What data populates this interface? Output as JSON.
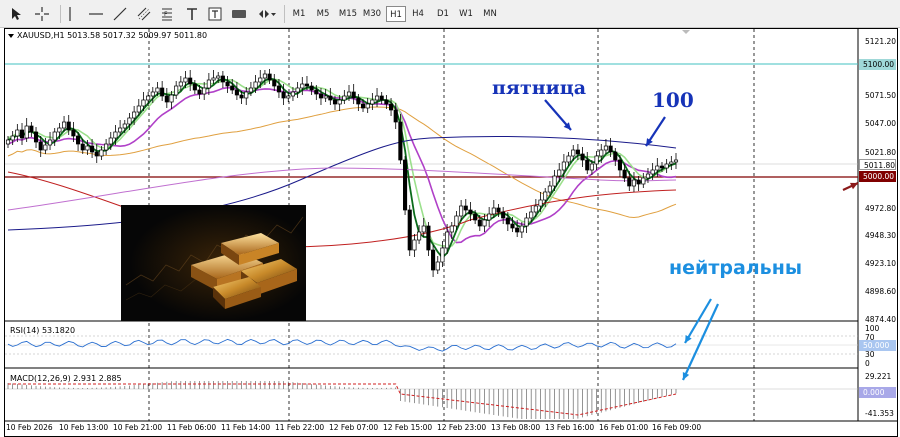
{
  "toolbar": {
    "timeframes": [
      "M1",
      "M5",
      "M15",
      "M30",
      "H1",
      "H4",
      "D1",
      "W1",
      "MN"
    ],
    "active_timeframe": "H1"
  },
  "chart": {
    "symbol_line": "XAUUSD,H1  5013.58 5017.32 5009.97 5011.80",
    "rsi_label": "RSI(14) 53.1820",
    "macd_label": "MACD(12,26,9) 2.931 2.885",
    "annotations": {
      "friday": "пятница",
      "hundred": "100",
      "neutral": "нейтральны"
    },
    "price_axis": [
      "5121.20",
      "5096.00",
      "5071.50",
      "5047.00",
      "5021.80",
      "4997.30",
      "4972.80",
      "4948.30",
      "4923.10",
      "4898.60",
      "4874.40"
    ],
    "price_boxes": {
      "level_5100": "5100.00",
      "current": "5011.80",
      "level_5000": "5000.00"
    },
    "rsi_axis": [
      "100",
      "70",
      "30",
      "0"
    ],
    "rsi_box": "50.000",
    "macd_axis": [
      "29.221",
      "-41.353"
    ],
    "macd_box": "0.000",
    "time_axis": [
      "10 Feb 2026",
      "10 Feb 13:00",
      "10 Feb 21:00",
      "11 Feb 06:00",
      "11 Feb 14:00",
      "11 Feb 22:00",
      "12 Feb 07:00",
      "12 Feb 15:00",
      "12 Feb 23:00",
      "13 Feb 08:00",
      "13 Feb 16:00",
      "16 Feb 01:00",
      "16 Feb 09:00"
    ],
    "colors": {
      "bull": "#ffffff",
      "bear": "#000000",
      "ma_fast_green": "#0b6b1b",
      "ma_light_green": "#9be08c",
      "ma_violet": "#b040c8",
      "ma_orange": "#e0a040",
      "ma_navy": "#1a1a8a",
      "ma_red": "#c02020",
      "level_5100": "#40c0c0",
      "level_5000": "#800000",
      "annotation_blue": "#1633b8",
      "annotation_lightblue": "#1c8fe0"
    }
  }
}
